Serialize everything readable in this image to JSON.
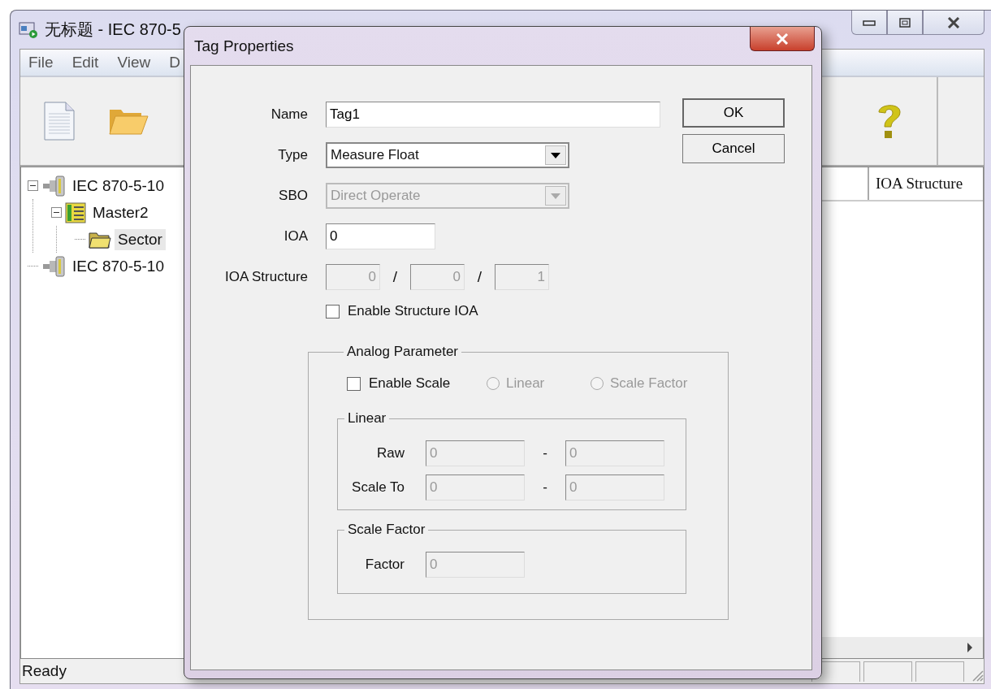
{
  "app_window": {
    "title": "无标题 - IEC 870-5",
    "menu": [
      "File",
      "Edit",
      "View",
      "D"
    ],
    "toolbar": [
      {
        "kind": "new"
      },
      {
        "kind": "open"
      },
      {
        "kind": "help"
      }
    ],
    "tree": [
      {
        "label": "IEC 870-5-10",
        "kind": "channel",
        "selected": false,
        "expanded": true,
        "children": [
          {
            "label": "Master2",
            "kind": "device",
            "selected": false,
            "expanded": true,
            "children": [
              {
                "label": "Sector",
                "kind": "sector",
                "selected": true
              }
            ]
          }
        ]
      },
      {
        "label": "IEC 870-5-10",
        "kind": "channel",
        "selected": false
      }
    ],
    "list": {
      "columns": [
        "IOA Structure"
      ]
    },
    "status_bar": "Ready"
  },
  "dialog": {
    "title": "Tag Properties",
    "fields": [
      {
        "label": "Name",
        "kind": "text",
        "value": "Tag1",
        "disabled": false
      },
      {
        "label": "Type",
        "kind": "dropdown",
        "value": "Measure Float",
        "disabled": false
      },
      {
        "label": "SBO",
        "kind": "dropdown",
        "value": "Direct Operate",
        "disabled": true
      },
      {
        "label": "IOA",
        "kind": "short",
        "value": "0",
        "disabled": false
      },
      {
        "label": "IOA Structure",
        "kind": "triple",
        "parts": [
          "0",
          "0",
          "1"
        ],
        "separators": [
          "/",
          "/"
        ],
        "disabled": true
      }
    ],
    "structure_checkbox": {
      "label": "Enable Structure IOA",
      "checked": false
    },
    "buttons": [
      "OK",
      "Cancel"
    ],
    "analog": {
      "title": "Analog Parameter",
      "enable_scale": {
        "label": "Enable Scale",
        "checked": false
      },
      "modes": [
        {
          "label": "Linear",
          "selected": false,
          "disabled": true
        },
        {
          "label": "Scale Factor",
          "selected": false,
          "disabled": true
        }
      ],
      "linear": {
        "title": "Linear",
        "rows": [
          {
            "label": "Raw",
            "from": "0",
            "separator": "-",
            "to": "0",
            "disabled": true
          },
          {
            "label": "Scale To",
            "from": "0",
            "separator": "-",
            "to": "0",
            "disabled": true
          }
        ]
      },
      "scale_factor": {
        "title": "Scale Factor",
        "label": "Factor",
        "value": "0",
        "disabled": true
      }
    }
  }
}
